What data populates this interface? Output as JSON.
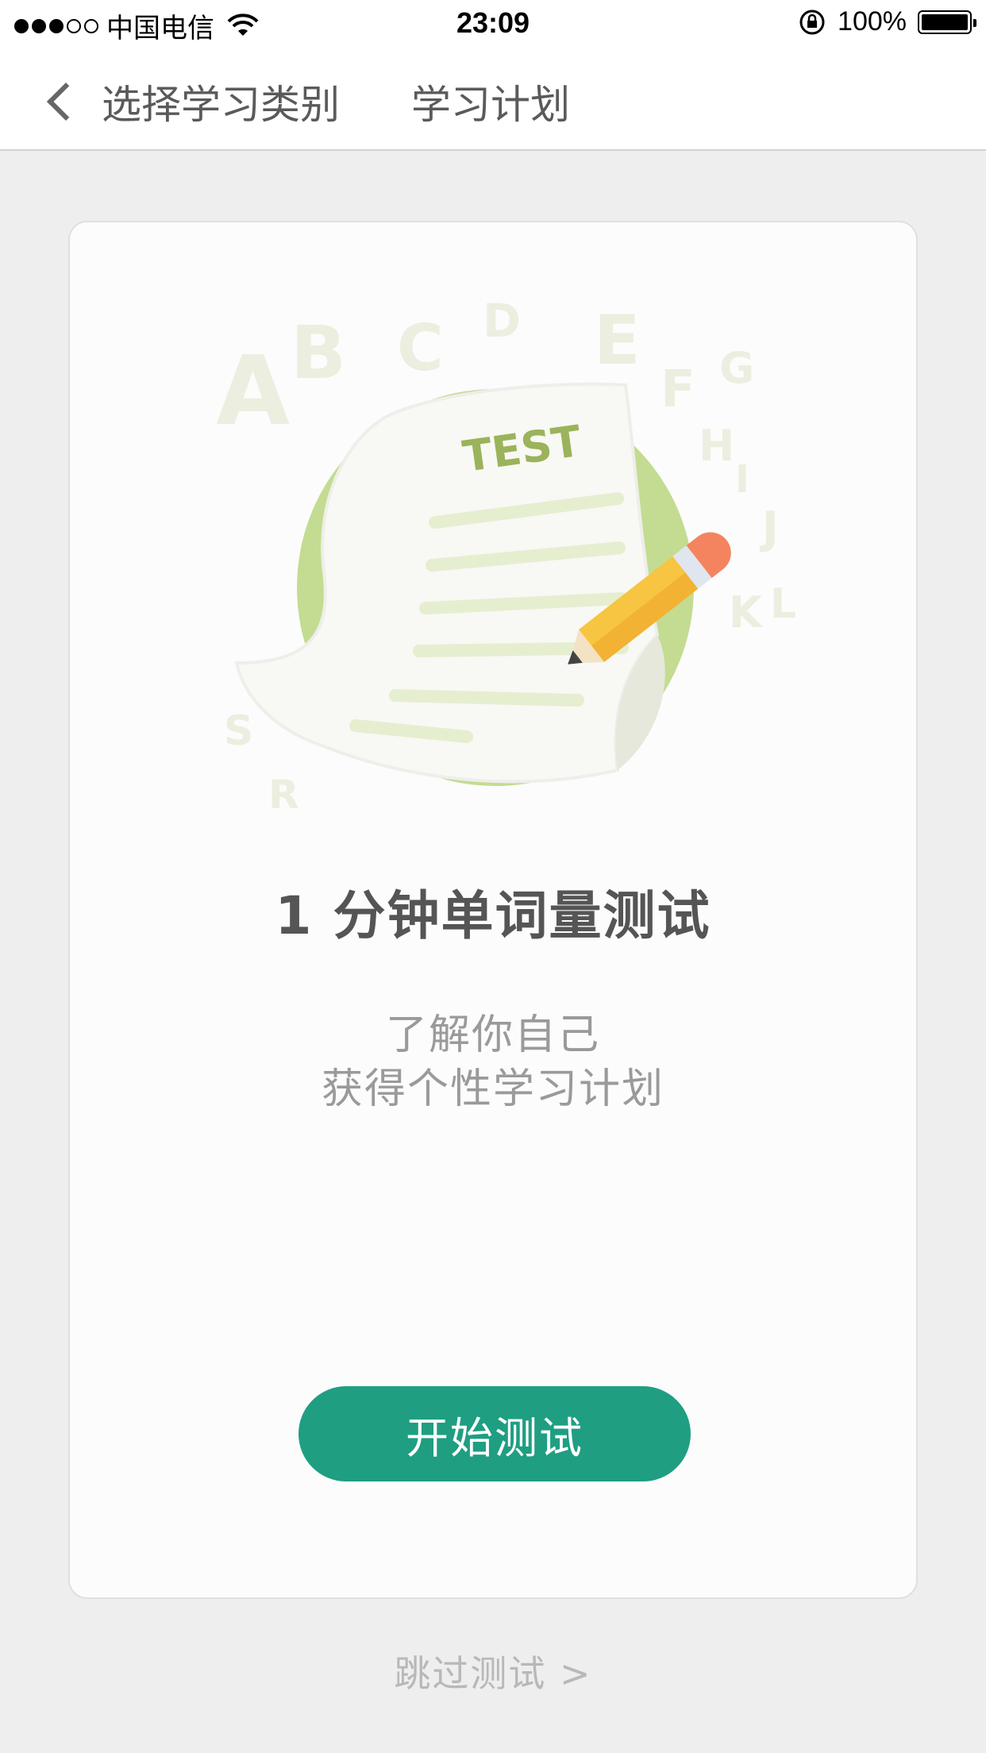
{
  "status_bar": {
    "carrier": "中国电信",
    "time": "23:09",
    "battery": "100%",
    "signal_bars_filled": 3,
    "signal_bars_total": 5
  },
  "nav": {
    "back_label": "选择学习类别",
    "title": "学习计划"
  },
  "card": {
    "illustration": {
      "sheet_label": "TEST",
      "letters": [
        "A",
        "B",
        "C",
        "D",
        "E",
        "F",
        "G",
        "H",
        "I",
        "J",
        "K",
        "L",
        "S",
        "R"
      ]
    },
    "title": "1 分钟单词量测试",
    "subtitle_line1": "了解你自己",
    "subtitle_line2": "获得个性学习计划",
    "start_button": "开始测试"
  },
  "skip_link": "跳过测试 >",
  "colors": {
    "accent": "#1f9e82",
    "circle_green": "#c3dc91",
    "pencil_yellow": "#f7c542",
    "pencil_eraser": "#f4845f"
  }
}
